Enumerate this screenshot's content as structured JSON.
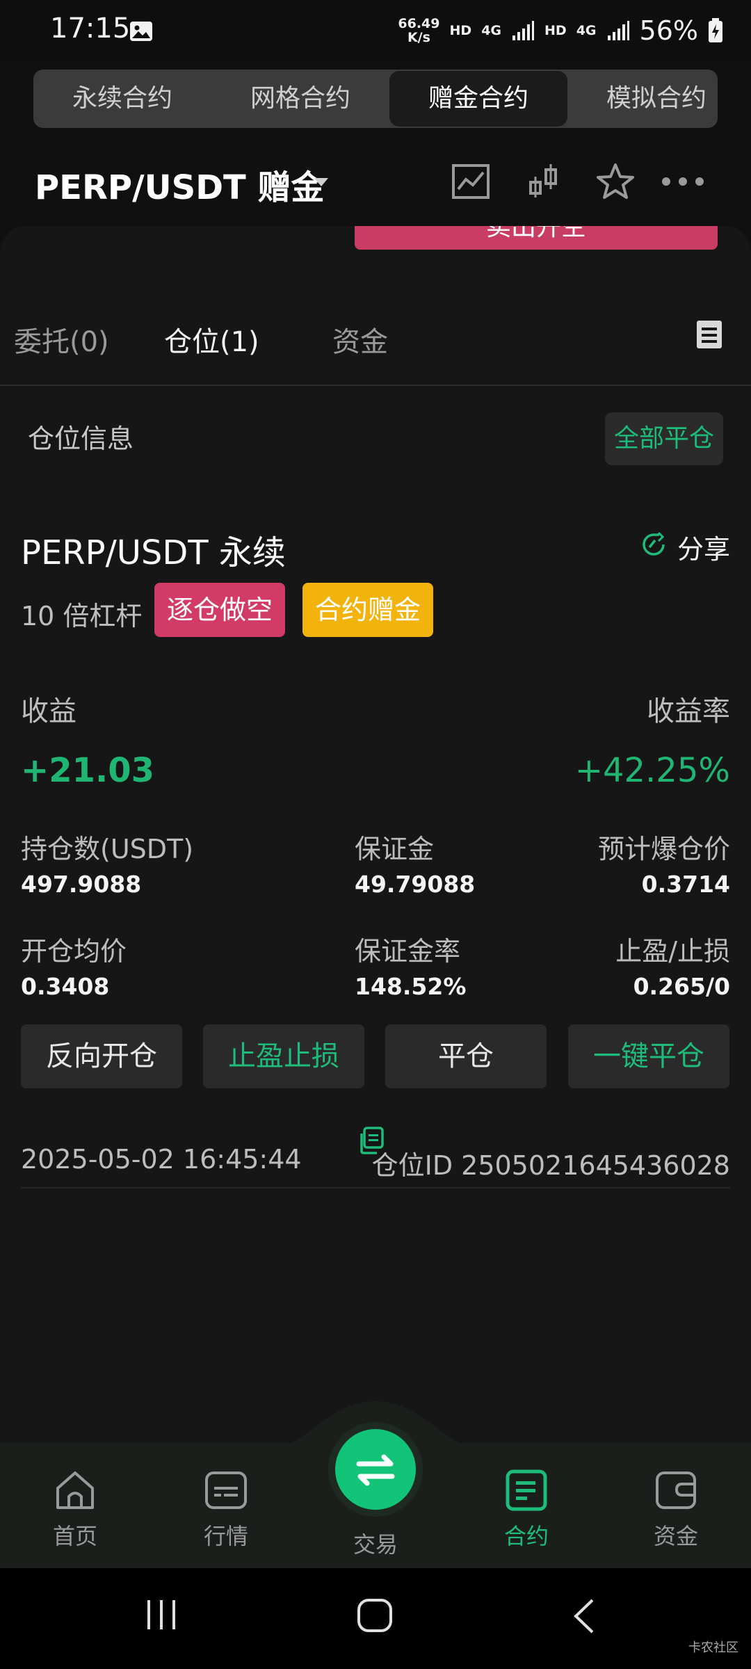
{
  "status_bar": {
    "time": "17:15",
    "net_speed_value": "66.49",
    "net_speed_unit": "K/s",
    "hd1": "HD",
    "net1": "4G",
    "hd2": "HD",
    "net2": "4G",
    "battery": "56%"
  },
  "top_tabs": [
    {
      "label": "永续合约",
      "active": false
    },
    {
      "label": "网格合约",
      "active": false
    },
    {
      "label": "赠金合约",
      "active": true
    },
    {
      "label": "模拟合约",
      "active": false
    }
  ],
  "header": {
    "pair": "PERP/USDT  赠金"
  },
  "sell_button": "卖出开空",
  "sheet_tabs": [
    {
      "label": "委托(0)",
      "active": false
    },
    {
      "label": "仓位(1)",
      "active": true
    },
    {
      "label": "资金",
      "active": false
    }
  ],
  "position": {
    "section_label": "仓位信息",
    "close_all": "全部平仓",
    "pair": "PERP/USDT 永续",
    "share": "分享",
    "leverage": "10 倍杠杆",
    "badge_short": "逐仓做空",
    "badge_bonus": "合约赠金",
    "profit_label": "收益",
    "profit_value": "+21.03",
    "rate_label": "收益率",
    "rate_value": "+42.25%",
    "holding_label": "持仓数(USDT)",
    "holding_value": "497.9088",
    "margin_label": "保证金",
    "margin_value": "49.79088",
    "liq_label": "预计爆仓价",
    "liq_value": "0.3714",
    "avg_label": "开仓均价",
    "avg_value": "0.3408",
    "margin_rate_label": "保证金率",
    "margin_rate_value": "148.52%",
    "tpsl_label": "止盈/止损",
    "tpsl_value": "0.265/0",
    "actions": [
      "反向开仓",
      "止盈止损",
      "平仓",
      "一键平仓"
    ],
    "timestamp": "2025-05-02 16:45:44",
    "position_id": "仓位ID 2505021645436028"
  },
  "bottom_nav": [
    {
      "label": "首页",
      "icon": "home-icon",
      "active": false
    },
    {
      "label": "行情",
      "icon": "market-icon",
      "active": false
    },
    {
      "label": "交易",
      "icon": "swap-icon",
      "active": false
    },
    {
      "label": "合约",
      "icon": "contract-icon",
      "active": true
    },
    {
      "label": "资金",
      "icon": "wallet-icon",
      "active": false
    }
  ],
  "watermark": "卡农社区",
  "colors": {
    "green": "#1ebc7a",
    "red_badge": "#d23b65",
    "yellow_badge": "#f1b30c",
    "background": "#161616"
  }
}
